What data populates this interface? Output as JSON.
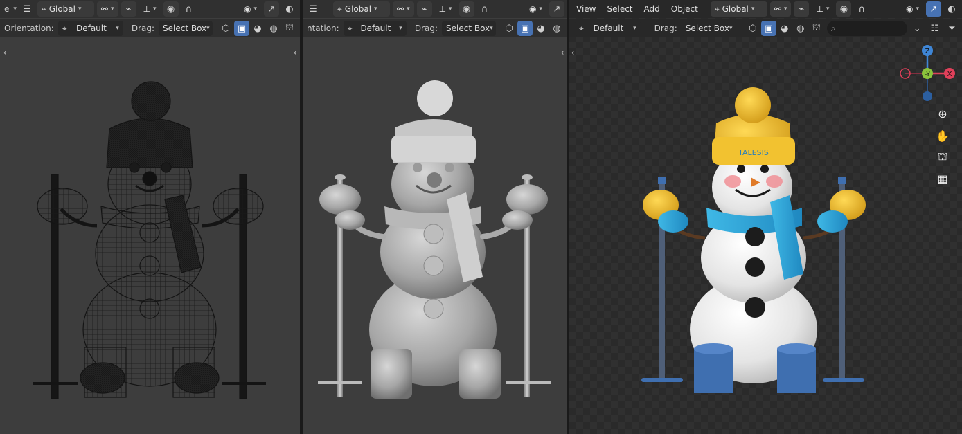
{
  "viewports": [
    {
      "id": "wireframe",
      "header": {
        "transform_space": "Global"
      },
      "tool_header": {
        "orientation_label": "Orientation:",
        "orientation_value": "Default",
        "drag_label": "Drag:",
        "drag_value": "Select Box"
      }
    },
    {
      "id": "solid",
      "header": {
        "transform_space": "Global"
      },
      "tool_header": {
        "orientation_label": "ntation:",
        "orientation_value": "Default",
        "drag_label": "Drag:",
        "drag_value": "Select Box"
      }
    },
    {
      "id": "rendered",
      "header": {
        "menu": [
          "View",
          "Select",
          "Add",
          "Object"
        ],
        "transform_space": "Global"
      },
      "tool_header": {
        "orientation_value": "Default",
        "drag_label": "Drag:",
        "drag_value": "Select Box"
      },
      "gizmo": {
        "z": "Z",
        "y": "-Y",
        "x": "X"
      },
      "hat_text": "TALESIS"
    }
  ],
  "icons": {
    "menu": "hamburger-icon",
    "transform": "transform-icon",
    "snap": "snap-icon",
    "proportional": "proportional-icon",
    "visibility": "eye-icon",
    "gizmo_toggle": "gizmo-icon",
    "overlay": "overlay-icon",
    "zoom": "zoom-icon",
    "pan": "hand-icon",
    "camera": "camera-icon",
    "grid": "grid-icon"
  },
  "colors": {
    "accent": "#4772b3",
    "hat_yellow": "#f2c230",
    "scarf_blue": "#2fa8d8",
    "boot_blue": "#3f6fb0",
    "axis_x": "#e0405a",
    "axis_y": "#8bc43c",
    "axis_z": "#3f86d6"
  }
}
